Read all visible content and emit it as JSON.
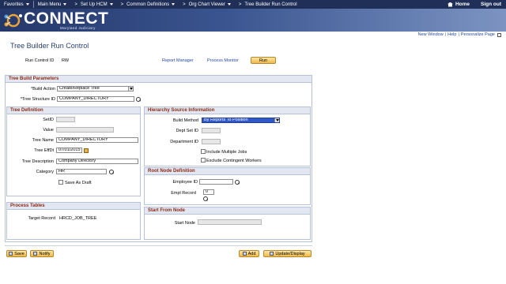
{
  "topnav": {
    "favorites": "Favorites",
    "main_menu": "Main Menu",
    "crumb1": "Set Up HCM",
    "crumb2": "Common Definitions",
    "crumb3": "Org Chart Viewer",
    "crumb4": "Tree Builder Run Control",
    "home": "Home",
    "signout": "Sign out"
  },
  "banner": {
    "logo_text": "CONNECT",
    "logo_sub": "Maryland Judiciary"
  },
  "pagelinks": {
    "new_window": "New Window",
    "help": "Help",
    "personalize": "Personalize Page",
    "sep": "|"
  },
  "page": {
    "title": "Tree Builder Run Control",
    "run_control_label": "Run Control ID",
    "run_control_value": "RW",
    "report_manager": "Report Manager",
    "process_monitor": "Process Monitor",
    "run_button": "Run"
  },
  "tree_build": {
    "header": "Tree Build Parameters",
    "build_action_label": "*Build Action",
    "build_action_value": "Create/Replace Tree",
    "tree_structure_label": "*Tree Structure ID",
    "tree_structure_value": "COMPANY_DIRECTORY"
  },
  "tree_def": {
    "header": "Tree Definition",
    "setid_label": "SetID",
    "setid_value": "",
    "value_label": "Value",
    "value_value": "",
    "tree_name_label": "Tree Name",
    "tree_name_value": "COMPANY_DIRECTORY",
    "effdt_label": "Tree EffDt",
    "effdt_value": "07/01/2015",
    "desc_label": "Tree Description",
    "desc_value": "Company Directory",
    "category_label": "Category",
    "category_value": "HR",
    "save_draft_label": "Save As Draft"
  },
  "hierarchy": {
    "header": "Hierarchy Source Information",
    "build_method_label": "Build Method",
    "build_method_value": "By Reports To Position",
    "deptset_label": "Dept Set ID",
    "department_label": "Department ID",
    "include_multiple_jobs": "Include Multiple Jobs",
    "exclude_contingent": "Exclude Contingent Workers"
  },
  "root_node": {
    "header": "Root Node Definition",
    "employee_id_label": "Employee ID",
    "empl_record_label": "Empl Record",
    "empl_record_value": "0"
  },
  "process_tables": {
    "header": "Process Tables",
    "target_record_label": "Target Record",
    "target_record_value": "HRCD_JOB_TREE"
  },
  "start_node": {
    "header": "Start From Node",
    "start_node_label": "Start Node"
  },
  "footer": {
    "save": "Save",
    "notify": "Notify",
    "add": "Add",
    "update_display": "Update/Display"
  },
  "colors": {
    "nav_bg": "#1f2f57",
    "section_header": "#8b2a16",
    "button_bg": "#f0b84a",
    "link": "#2448a0"
  }
}
